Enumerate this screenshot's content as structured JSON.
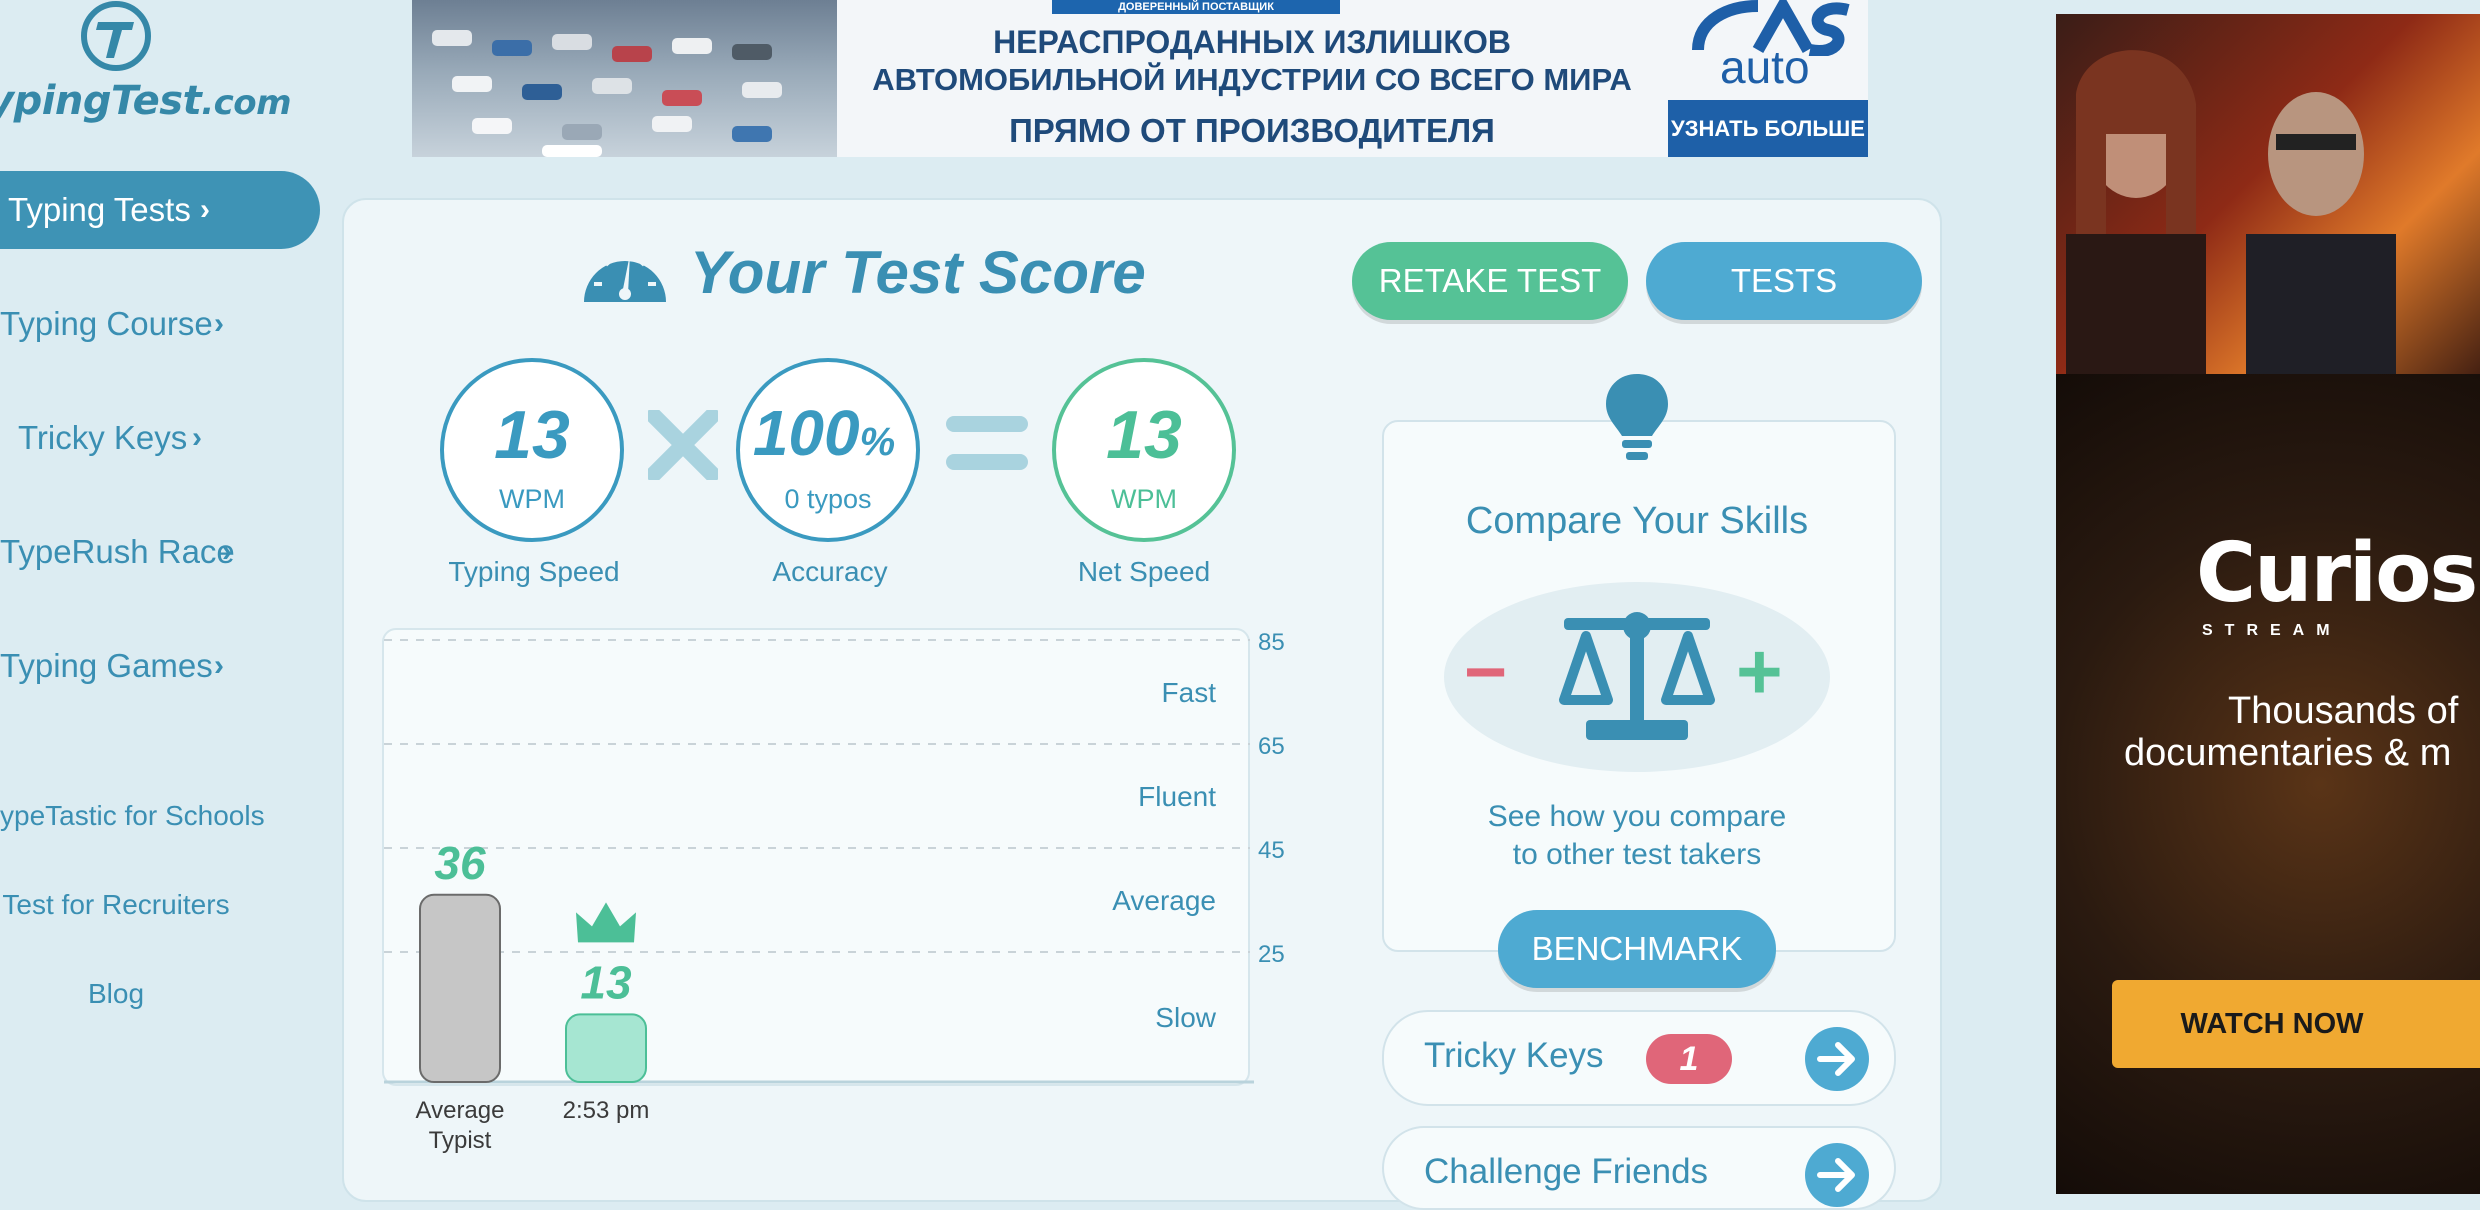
{
  "sidebar": {
    "logo": {
      "text": "ypingTest",
      "suffix": ".com"
    },
    "nav": [
      {
        "label": "Typing Tests",
        "active": true
      },
      {
        "label": "Typing Course",
        "active": false
      },
      {
        "label": "Tricky Keys",
        "active": false
      },
      {
        "label": "TypeRush Race",
        "active": false
      },
      {
        "label": "Typing Games",
        "active": false
      }
    ],
    "links": [
      "ypeTastic for Schools",
      "Test for Recruiters",
      "Blog"
    ]
  },
  "ad_top": {
    "badge": "ДОВЕРЕННЫЙ ПОСТАВЩИК",
    "line1": "НЕРАСПРОДАННЫХ ИЗЛИШКОВ",
    "line2": "АВТОМОБИЛЬНОЙ ИНДУСТРИИ СО ВСЕГО МИРА",
    "line3": "ПРЯМО ОТ ПРОИЗВОДИТЕЛЯ",
    "brand": "auto",
    "cta": "УЗНАТЬ БОЛЬШЕ"
  },
  "ad_right": {
    "brand": "Curiosit",
    "sub": "STREAM",
    "line1": "Thousands of",
    "line2": "documentaries & m",
    "cta": "WATCH NOW"
  },
  "score": {
    "title": "Your Test Score",
    "retake_label": "RETAKE TEST",
    "tests_label": "TESTS",
    "typing_speed": {
      "value": "13",
      "unit": "WPM",
      "caption": "Typing Speed"
    },
    "accuracy": {
      "value": "100",
      "percent": "%",
      "typos": "0  typos",
      "caption": "Accuracy"
    },
    "net_speed": {
      "value": "13",
      "unit": "WPM",
      "caption": "Net Speed"
    }
  },
  "chart_data": {
    "type": "bar",
    "categories": [
      "Average Typist",
      "2:53 pm"
    ],
    "values": [
      36,
      13
    ],
    "value_labels": [
      "36",
      "13"
    ],
    "category_lines": [
      [
        "Average",
        "Typist"
      ],
      [
        "2:53 pm"
      ]
    ],
    "y_ticks": [
      85,
      65,
      45,
      25
    ],
    "bands": [
      "Fast",
      "Fluent",
      "Average",
      "Slow"
    ],
    "ylim": [
      0,
      85
    ],
    "grid": true,
    "colors": {
      "average": "#c6c6c6",
      "you": "#a6e6d2",
      "label_green": "#4cbf97",
      "grid": "#c9d3d8"
    }
  },
  "compare": {
    "title": "Compare Your Skills",
    "desc_line1": "See how you compare",
    "desc_line2": "to other test takers",
    "minus": "−",
    "plus": "+",
    "benchmark_label": "BENCHMARK"
  },
  "tricky_keys": {
    "label": "Tricky Keys",
    "count": "1"
  },
  "challenge": {
    "label": "Challenge Friends"
  },
  "colors": {
    "blue": "#3a8fb3",
    "green": "#55c296",
    "pill_blue": "#4eaad2",
    "red": "#e06679"
  }
}
